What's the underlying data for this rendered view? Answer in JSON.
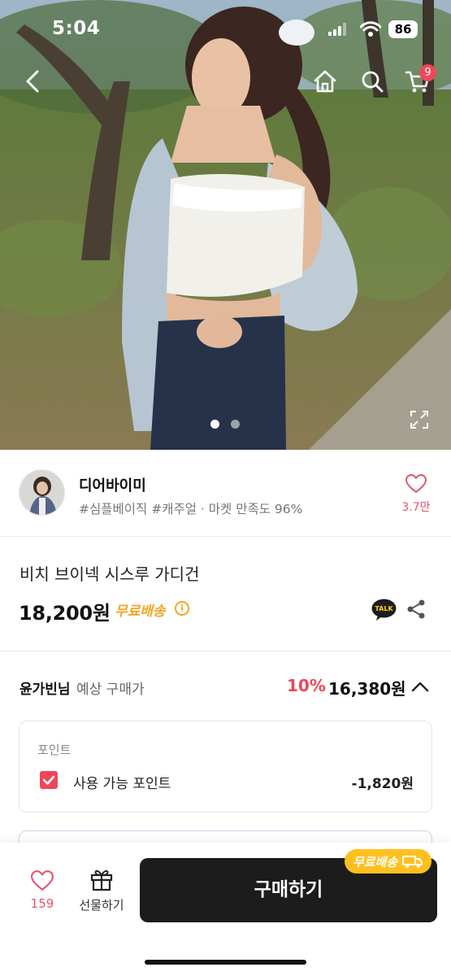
{
  "status_bar": {
    "time": "5:04",
    "battery": "86"
  },
  "nav": {
    "cart_count": "9"
  },
  "gallery": {
    "image_count": 2,
    "current": 1
  },
  "seller": {
    "name": "디어바이미",
    "tags": "#심플베이직 #캐주얼 · 마켓 만족도 96%",
    "likes": "3.7만"
  },
  "product": {
    "title": "비치 브이넥 시스루 가디건",
    "price": "18,200원",
    "shipping": "무료배송",
    "talk_label": "TALK"
  },
  "member_price": {
    "user": "윤가빈님",
    "label": "예상 구매가",
    "discount": "10%",
    "price": "16,380원",
    "points": {
      "heading": "포인트",
      "item_label": "사용 가능 포인트",
      "item_value": "-1,820원",
      "checked": true
    }
  },
  "bottom_bar": {
    "wish_count": "159",
    "gift_label": "선물하기",
    "buy_label": "구매하기",
    "ship_badge": "무료배송"
  },
  "colors": {
    "accent": "#f0465a",
    "ship": "#f5a623",
    "badge": "#ffc01f",
    "buy": "#1c1c1c"
  }
}
